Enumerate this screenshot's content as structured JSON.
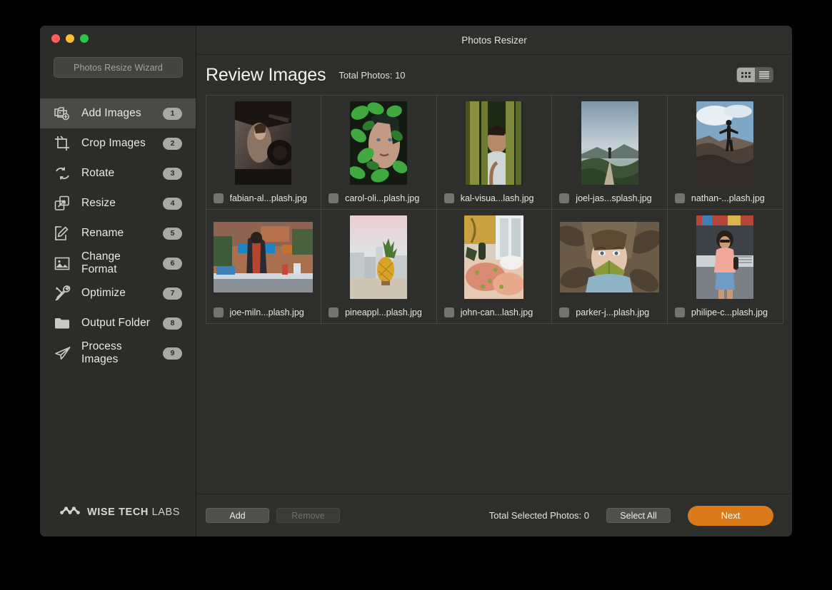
{
  "window": {
    "title": "Photos Resizer",
    "traffic_lights": [
      {
        "name": "close",
        "color": "#ff5f57"
      },
      {
        "name": "minimize",
        "color": "#febc2e"
      },
      {
        "name": "maximize",
        "color": "#28c840"
      }
    ]
  },
  "sidebar": {
    "wizard_button": "Photos Resize Wizard",
    "items": [
      {
        "label": "Add Images",
        "badge": "1",
        "icon": "add-images-icon",
        "active": true
      },
      {
        "label": "Crop Images",
        "badge": "2",
        "icon": "crop-icon",
        "active": false
      },
      {
        "label": "Rotate",
        "badge": "3",
        "icon": "rotate-icon",
        "active": false
      },
      {
        "label": "Resize",
        "badge": "4",
        "icon": "resize-icon",
        "active": false
      },
      {
        "label": "Rename",
        "badge": "5",
        "icon": "rename-icon",
        "active": false
      },
      {
        "label": "Change Format",
        "badge": "6",
        "icon": "image-icon",
        "active": false
      },
      {
        "label": "Optimize",
        "badge": "7",
        "icon": "optimize-icon",
        "active": false
      },
      {
        "label": "Output Folder",
        "badge": "8",
        "icon": "folder-icon",
        "active": false
      },
      {
        "label": "Process Images",
        "badge": "9",
        "icon": "paper-plane-icon",
        "active": false
      }
    ],
    "brand": {
      "bold": "WISE TECH ",
      "light": "LABS",
      "icon": "wise-tech-labs-logo-icon"
    }
  },
  "header": {
    "page_title": "Review Images",
    "total_photos": "Total Photos: 10",
    "view_grid_icon": "grid-view-icon",
    "view_list_icon": "list-view-icon",
    "active_view": "grid"
  },
  "photos": [
    {
      "filename": "fabian-al...plash.jpg",
      "checked": false,
      "orient": "portrait",
      "theme": "car-interior-woman"
    },
    {
      "filename": "carol-oli...plash.jpg",
      "checked": false,
      "orient": "portrait",
      "theme": "woman-green-leaves"
    },
    {
      "filename": "kal-visua...lash.jpg",
      "checked": false,
      "orient": "portrait",
      "theme": "woman-bamboo"
    },
    {
      "filename": "joel-jas...splash.jpg",
      "checked": false,
      "orient": "portrait",
      "theme": "mountain-hiker"
    },
    {
      "filename": "nathan-...plash.jpg",
      "checked": false,
      "orient": "portrait",
      "theme": "man-on-rocks-sky"
    },
    {
      "filename": "joe-miln...plash.jpg",
      "checked": false,
      "orient": "landscape",
      "theme": "street-market-person"
    },
    {
      "filename": "pineappl...plash.jpg",
      "checked": false,
      "orient": "portrait",
      "theme": "pineapple-city"
    },
    {
      "filename": "john-can...lash.jpg",
      "checked": false,
      "orient": "portrait",
      "theme": "food-table-window"
    },
    {
      "filename": "parker-j...plash.jpg",
      "checked": false,
      "orient": "landscape",
      "theme": "woman-leaf-leaves"
    },
    {
      "filename": "philipe-c...plash.jpg",
      "checked": false,
      "orient": "portrait",
      "theme": "woman-van-pink"
    }
  ],
  "footer": {
    "add_label": "Add",
    "remove_label": "Remove",
    "remove_disabled": true,
    "selected_count": "Total Selected Photos: 0",
    "select_all_label": "Select All",
    "next_label": "Next",
    "next_color": "#da7a1b"
  }
}
